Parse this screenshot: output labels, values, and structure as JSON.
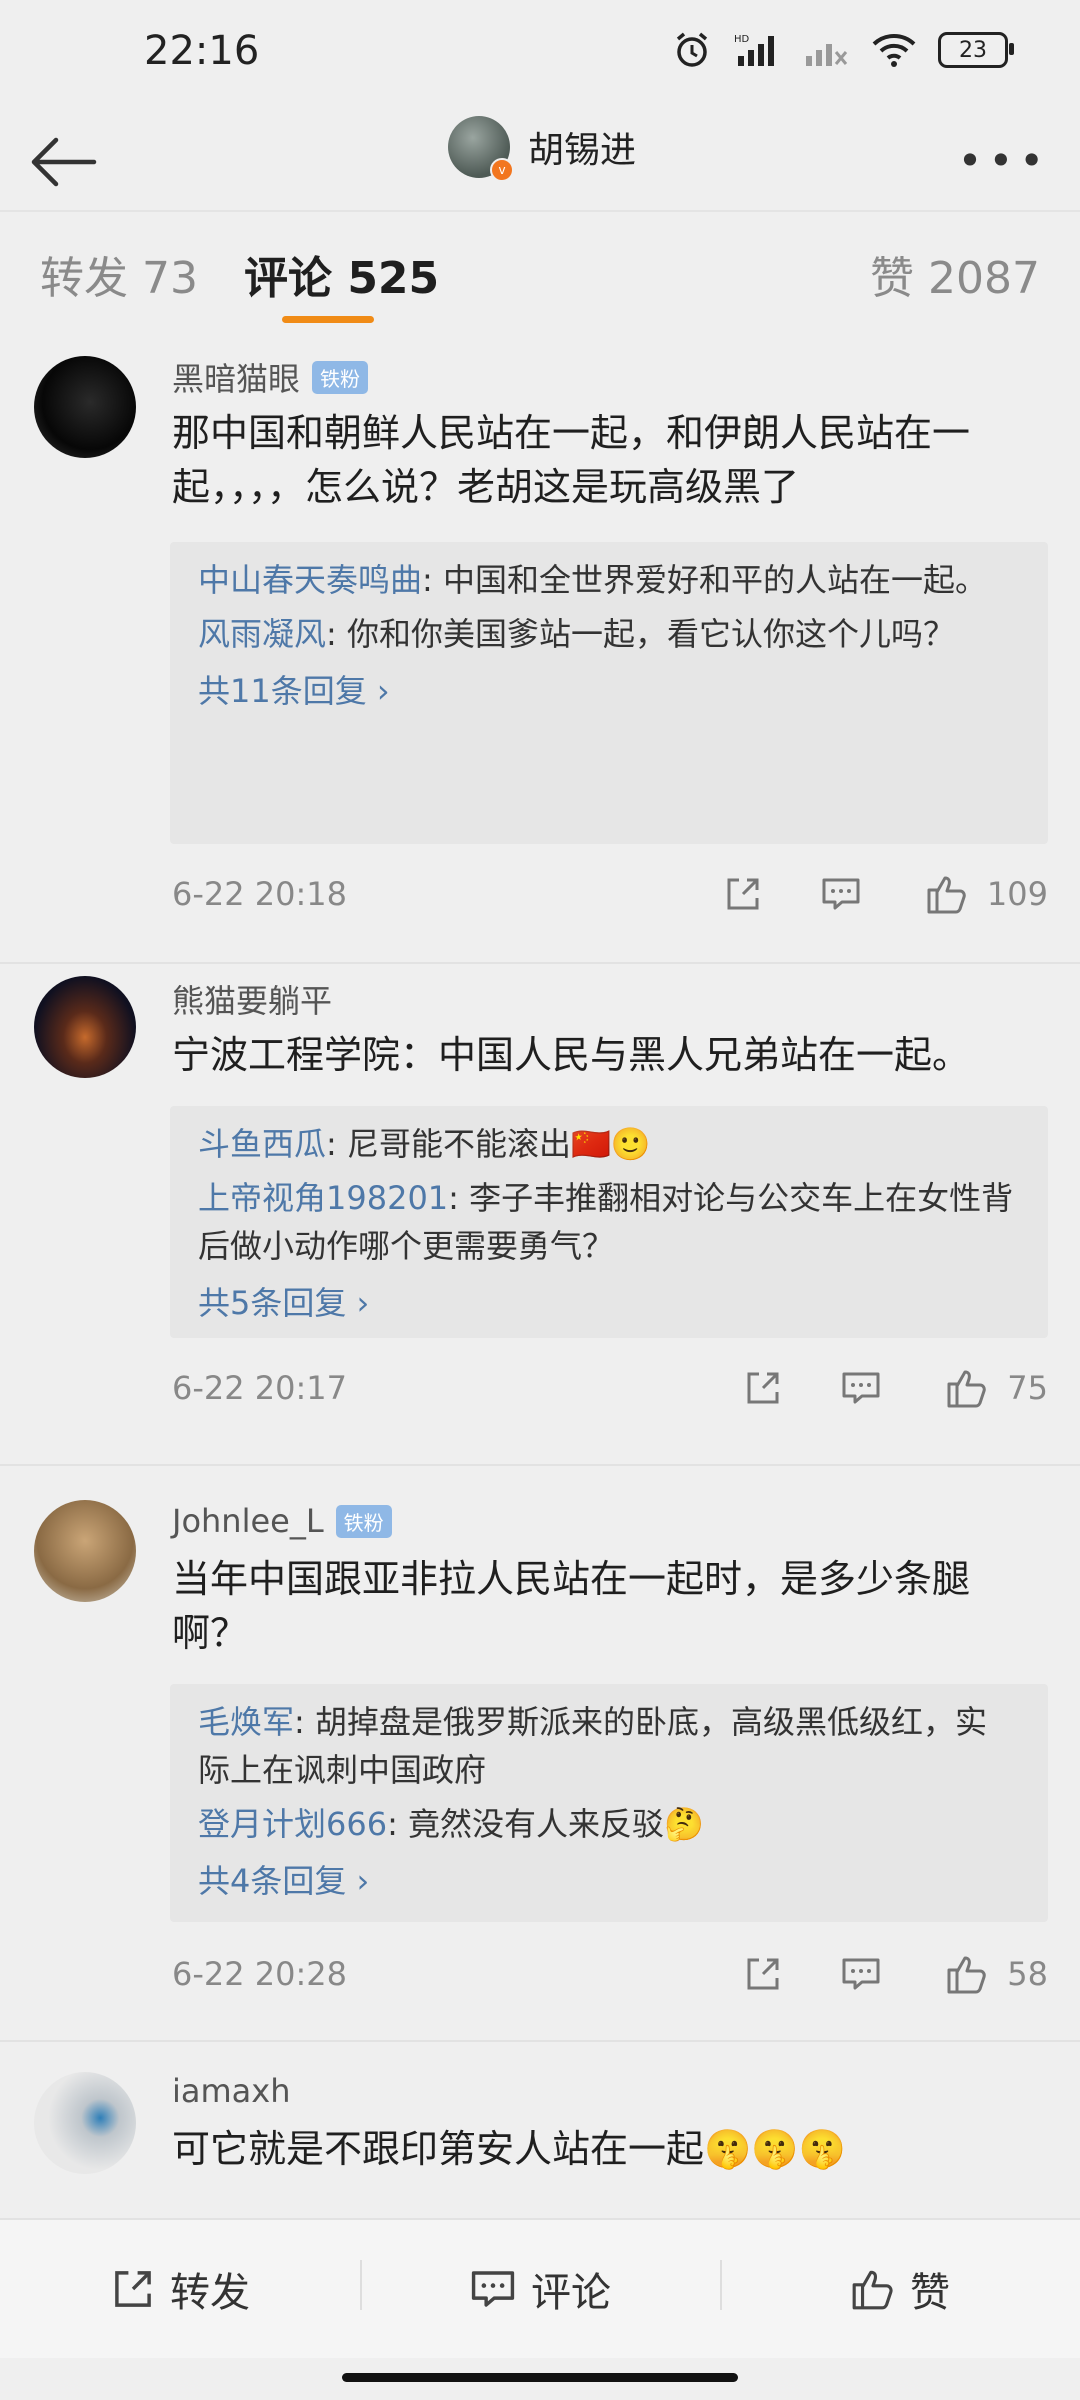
{
  "status_bar": {
    "time": "22:16",
    "battery": "23"
  },
  "header": {
    "title": "胡锡进"
  },
  "tabs": {
    "repost": "转发 73",
    "comment": "评论 525",
    "like": "赞 2087"
  },
  "comments": [
    {
      "author": "黑暗猫眼",
      "badge": "铁粉",
      "text": "那中国和朝鲜人民站在一起，和伊朗人民站在一起，，，，怎么说？老胡这是玩高级黑了",
      "replies": [
        {
          "name": "中山春天奏鸣曲",
          "text": ": 中国和全世界爱好和平的人站在一起。"
        },
        {
          "name": "风雨凝风",
          "text": ": 你和你美国爹站一起，看它认你这个儿吗？"
        }
      ],
      "more": "共11条回复 ›",
      "time": "6-22 20:18",
      "likes": "109"
    },
    {
      "author": "熊猫要躺平",
      "badge": "",
      "text": "宁波工程学院：中国人民与黑人兄弟站在一起。",
      "replies": [
        {
          "name": "斗鱼西瓜",
          "text": ": 尼哥能不能滚出🇨🇳🙂"
        },
        {
          "name": "上帝视角198201",
          "text": ": 李子丰推翻相对论与公交车上在女性背后做小动作哪个更需要勇气？"
        }
      ],
      "more": "共5条回复 ›",
      "time": "6-22 20:17",
      "likes": "75"
    },
    {
      "author": "Johnlee_L",
      "badge": "铁粉",
      "text": "当年中国跟亚非拉人民站在一起时，是多少条腿啊？",
      "replies": [
        {
          "name": "毛焕军",
          "text": ": 胡掉盘是俄罗斯派来的卧底，高级黑低级红，实际上在讽刺中国政府"
        },
        {
          "name": "登月计划666",
          "text": ": 竟然没有人来反驳🤔"
        }
      ],
      "more": "共4条回复 ›",
      "time": "6-22 20:28",
      "likes": "58"
    },
    {
      "author": "iamaxh",
      "badge": "",
      "text": "可它就是不跟印第安人站在一起🤫🤫🤫"
    }
  ],
  "bottom_bar": {
    "repost": "转发",
    "comment": "评论",
    "like": "赞"
  }
}
